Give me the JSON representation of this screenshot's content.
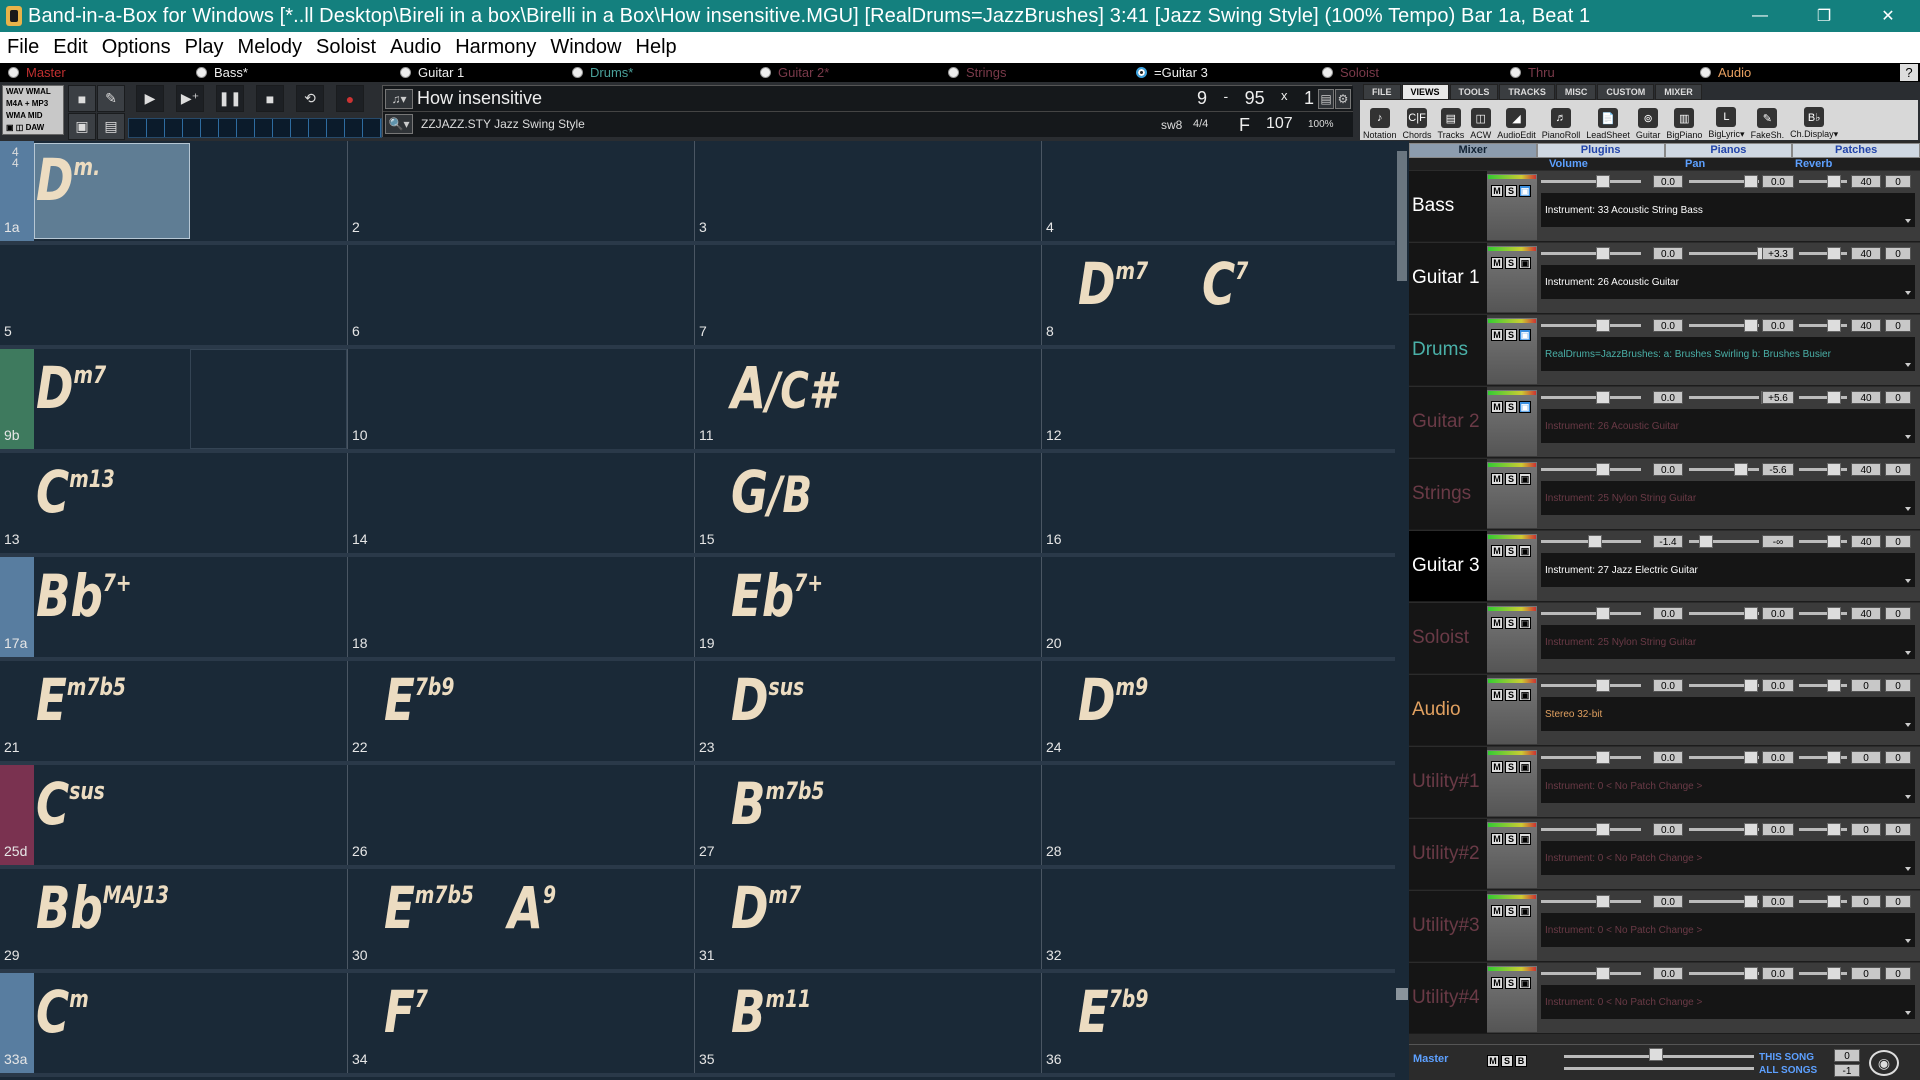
{
  "window": {
    "title": "Band-in-a-Box for Windows  [*..ll Desktop\\Bireli in a box\\Birelli in a Box\\How insensitive.MGU] [RealDrums=JazzBrushes]   3:41  [Jazz Swing Style] (100% Tempo)  Bar 1a, Beat 1",
    "minimize": "—",
    "restore": "❐",
    "close": "✕"
  },
  "menu": [
    "File",
    "Edit",
    "Options",
    "Play",
    "Melody",
    "Soloist",
    "Audio",
    "Harmony",
    "Window",
    "Help"
  ],
  "tracks": [
    {
      "label": "Master",
      "color": "#c03030"
    },
    {
      "label": "Bass*",
      "color": "#eeeeee"
    },
    {
      "label": "Guitar 1",
      "color": "#eeeeee"
    },
    {
      "label": "Drums*",
      "color": "#4aa09a"
    },
    {
      "label": "Guitar 2*",
      "color": "#7a3a4a"
    },
    {
      "label": "Strings",
      "color": "#7a3a4a"
    },
    {
      "label": "=Guitar 3",
      "color": "#eeeeee"
    },
    {
      "label": "Soloist",
      "color": "#7a3a4a"
    },
    {
      "label": "Thru",
      "color": "#7a3a4a"
    },
    {
      "label": "Audio",
      "color": "#e8a060"
    }
  ],
  "help_label": "?",
  "formats": {
    "l1": "WAV    WMAL",
    "l2": "M4A  +  MP3",
    "l3": "WMA      MID",
    "l4": "▣ ◫  DAW"
  },
  "song": {
    "title": "How insensitive",
    "style": "ZZJAZZ.STY Jazz Swing Style",
    "loop_start": "9",
    "dash": "-",
    "loop_end": "95",
    "times": "x",
    "choruses": "1",
    "feel": "sw8",
    "meter": "4/4",
    "key": "F",
    "tempo": "107",
    "tempo_pct": "100%"
  },
  "right_tabs": [
    "FILE",
    "VIEWS",
    "TOOLS",
    "TRACKS",
    "MISC",
    "CUSTOM",
    "MIXER"
  ],
  "right_icons": [
    "Notation",
    "Chords",
    "Tracks",
    "ACW",
    "AudioEdit",
    "PianoRoll",
    "LeadSheet",
    "Guitar",
    "BigPiano",
    "BigLyric▾",
    "FakeSh.",
    "Ch.Display▾"
  ],
  "sheet": {
    "timesig": "4\n4",
    "rows": [
      {
        "mark": "1a",
        "color": "#587da0",
        "cells": [
          {
            "n": "",
            "ch": [
              {
                "r": "D",
                "e": "m."
              }
            ]
          },
          {
            "n": "2",
            "ch": []
          },
          {
            "n": "3",
            "ch": []
          },
          {
            "n": "4",
            "ch": []
          }
        ]
      },
      {
        "mark": "",
        "color": "",
        "cells": [
          {
            "n": "5",
            "ch": []
          },
          {
            "n": "6",
            "ch": []
          },
          {
            "n": "7",
            "ch": []
          },
          {
            "n": "8",
            "ch": [
              {
                "r": "D",
                "e": "m7"
              },
              {
                "r": "C",
                "e": "7",
                "second": true
              }
            ]
          }
        ]
      },
      {
        "mark": "9b",
        "color": "#3e7a5e",
        "cells": [
          {
            "n": "",
            "ch": [
              {
                "r": "D",
                "e": "m7"
              }
            ]
          },
          {
            "n": "10",
            "ch": []
          },
          {
            "n": "11",
            "ch": [
              {
                "r": "A",
                "s": "/C#"
              }
            ]
          },
          {
            "n": "12",
            "ch": []
          }
        ]
      },
      {
        "mark": "",
        "color": "",
        "cells": [
          {
            "n": "13",
            "ch": [
              {
                "r": "C",
                "e": "m13"
              }
            ]
          },
          {
            "n": "14",
            "ch": []
          },
          {
            "n": "15",
            "ch": [
              {
                "r": "G",
                "s": "/B"
              }
            ]
          },
          {
            "n": "16",
            "ch": []
          }
        ]
      },
      {
        "mark": "17a",
        "color": "#587da0",
        "cells": [
          {
            "n": "",
            "ch": [
              {
                "r": "Bb",
                "e": "7+"
              }
            ]
          },
          {
            "n": "18",
            "ch": []
          },
          {
            "n": "19",
            "ch": [
              {
                "r": "Eb",
                "e": "7+"
              }
            ]
          },
          {
            "n": "20",
            "ch": []
          }
        ]
      },
      {
        "mark": "",
        "color": "",
        "cells": [
          {
            "n": "21",
            "ch": [
              {
                "r": "E",
                "e": "m7b5"
              }
            ]
          },
          {
            "n": "22",
            "ch": [
              {
                "r": "E",
                "e": "7b9"
              }
            ]
          },
          {
            "n": "23",
            "ch": [
              {
                "r": "D",
                "e": "sus"
              }
            ]
          },
          {
            "n": "24",
            "ch": [
              {
                "r": "D",
                "e": "m9"
              }
            ]
          }
        ]
      },
      {
        "mark": "25d",
        "color": "#7a3250",
        "cells": [
          {
            "n": "",
            "ch": [
              {
                "r": "C",
                "e": "sus"
              }
            ]
          },
          {
            "n": "26",
            "ch": []
          },
          {
            "n": "27",
            "ch": [
              {
                "r": "B",
                "e": "m7b5"
              }
            ]
          },
          {
            "n": "28",
            "ch": []
          }
        ]
      },
      {
        "mark": "",
        "color": "",
        "cells": [
          {
            "n": "29",
            "ch": [
              {
                "r": "Bb",
                "e": "MAJ13"
              }
            ]
          },
          {
            "n": "30",
            "ch": [
              {
                "r": "E",
                "e": "m7b5"
              },
              {
                "r": "A",
                "e": "9",
                "second": true
              }
            ]
          },
          {
            "n": "31",
            "ch": [
              {
                "r": "D",
                "e": "m7"
              }
            ]
          },
          {
            "n": "32",
            "ch": []
          }
        ]
      },
      {
        "mark": "33a",
        "color": "#587da0",
        "cells": [
          {
            "n": "",
            "ch": [
              {
                "r": "C",
                "e": "m"
              }
            ]
          },
          {
            "n": "34",
            "ch": [
              {
                "r": "F",
                "e": "7"
              }
            ]
          },
          {
            "n": "35",
            "ch": [
              {
                "r": "B",
                "e": "m11"
              }
            ]
          },
          {
            "n": "36",
            "ch": [
              {
                "r": "E",
                "e": "7b9"
              }
            ]
          }
        ]
      }
    ]
  },
  "mixer": {
    "tabs": [
      "Mixer",
      "Plugins",
      "Pianos",
      "Patches"
    ],
    "headers": {
      "volume": "Volume",
      "pan": "Pan",
      "reverb": "Reverb"
    },
    "rows": [
      {
        "name": "Bass",
        "name_color": "#ffffff",
        "name_bg": "#151515",
        "vol": "0.0",
        "pan": "0.0",
        "rev": "40",
        "tone": "0",
        "instr": "Instrument: 33 Acoustic String Bass",
        "instr_color": "#ffffff",
        "ch": true
      },
      {
        "name": "Guitar 1",
        "name_color": "#ffffff",
        "name_bg": "#151515",
        "vol": "0.0",
        "pan": "+3.3",
        "rev": "40",
        "tone": "0",
        "instr": "Instrument: 26 Acoustic Guitar",
        "instr_color": "#ffffff",
        "ch": false
      },
      {
        "name": "Drums",
        "name_color": "#4ab0a8",
        "name_bg": "#151515",
        "vol": "0.0",
        "pan": "0.0",
        "rev": "40",
        "tone": "0",
        "instr": "RealDrums=JazzBrushes: a: Brushes Swirling b: Brushes Busier",
        "instr_color": "#4ab0a8",
        "ch": true
      },
      {
        "name": "Guitar 2",
        "name_color": "#6a3a46",
        "name_bg": "#151515",
        "vol": "0.0",
        "pan": "+5.6",
        "rev": "40",
        "tone": "0",
        "instr": "Instrument: 26 Acoustic Guitar",
        "instr_color": "#6a3a46",
        "ch": true
      },
      {
        "name": "Strings",
        "name_color": "#6a3a46",
        "name_bg": "#151515",
        "vol": "0.0",
        "pan": "-5.6",
        "rev": "40",
        "tone": "0",
        "instr": "Instrument: 25 Nylon String Guitar",
        "instr_color": "#6a3a46",
        "ch": false
      },
      {
        "name": "Guitar 3",
        "name_color": "#ffffff",
        "name_bg": "#000000",
        "vol": "-1.4",
        "pan": "-∞",
        "rev": "40",
        "tone": "0",
        "instr": "Instrument: 27 Jazz Electric Guitar",
        "instr_color": "#ffffff",
        "ch": false
      },
      {
        "name": "Soloist",
        "name_color": "#6a3a46",
        "name_bg": "#151515",
        "vol": "0.0",
        "pan": "0.0",
        "rev": "40",
        "tone": "0",
        "instr": "Instrument: 25 Nylon String Guitar",
        "instr_color": "#6a3a46",
        "ch": false
      },
      {
        "name": "Audio",
        "name_color": "#e0a060",
        "name_bg": "#151515",
        "vol": "0.0",
        "pan": "0.0",
        "rev": "0",
        "tone": "0",
        "instr": "Stereo 32-bit",
        "instr_color": "#e0a060",
        "ch": false
      },
      {
        "name": "Utility#1",
        "name_color": "#6a3a46",
        "name_bg": "#151515",
        "vol": "0.0",
        "pan": "0.0",
        "rev": "0",
        "tone": "0",
        "instr": "Instrument: 0 < No Patch Change >",
        "instr_color": "#6a3a46",
        "ch": false
      },
      {
        "name": "Utility#2",
        "name_color": "#6a3a46",
        "name_bg": "#151515",
        "vol": "0.0",
        "pan": "0.0",
        "rev": "0",
        "tone": "0",
        "instr": "Instrument: 0 < No Patch Change >",
        "instr_color": "#6a3a46",
        "ch": false
      },
      {
        "name": "Utility#3",
        "name_color": "#6a3a46",
        "name_bg": "#151515",
        "vol": "0.0",
        "pan": "0.0",
        "rev": "0",
        "tone": "0",
        "instr": "Instrument: 0 < No Patch Change >",
        "instr_color": "#6a3a46",
        "ch": false
      },
      {
        "name": "Utility#4",
        "name_color": "#6a3a46",
        "name_bg": "#151515",
        "vol": "0.0",
        "pan": "0.0",
        "rev": "0",
        "tone": "0",
        "instr": "Instrument: 0 < No Patch Change >",
        "instr_color": "#6a3a46",
        "ch": false
      }
    ],
    "master": {
      "label": "Master",
      "this_song": "THIS SONG",
      "all_songs": "ALL SONGS",
      "v1": "0",
      "v2": "-1"
    }
  }
}
